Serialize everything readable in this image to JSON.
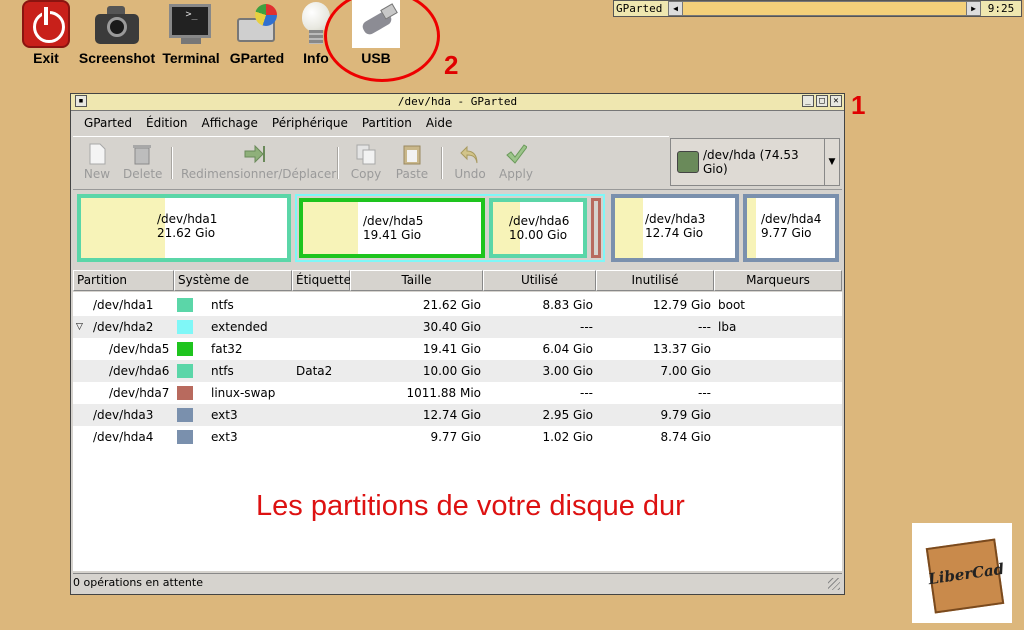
{
  "desktop": {
    "launchers": [
      {
        "label": "Exit",
        "icon": "power-icon"
      },
      {
        "label": "Screenshot",
        "icon": "camera-icon"
      },
      {
        "label": "Terminal",
        "icon": "terminal-icon"
      },
      {
        "label": "GParted",
        "icon": "gparted-icon"
      },
      {
        "label": "Info",
        "icon": "lightbulb-icon"
      },
      {
        "label": "USB",
        "icon": "usb-stick-icon"
      }
    ],
    "terminal_prompt": ">_",
    "annotation_1": "1",
    "annotation_2": "2",
    "caption": "Les partitions de votre disque dur",
    "logo_text": "LiberCad"
  },
  "taskbar": {
    "task_name": "GParted",
    "left_arrow": "◀",
    "right_arrow": "▶",
    "clock": "9:25"
  },
  "window": {
    "title": "/dev/hda - GParted",
    "menu": [
      "GParted",
      "Édition",
      "Affichage",
      "Périphérique",
      "Partition",
      "Aide"
    ],
    "toolbar": {
      "new": "New",
      "delete": "Delete",
      "resize": "Redimensionner/Déplacer",
      "copy": "Copy",
      "paste": "Paste",
      "undo": "Undo",
      "apply": "Apply"
    },
    "device_selector": "/dev/hda  (74.53 Gio)",
    "disk_map": [
      {
        "name": "/dev/hda1",
        "size": "21.62 Gio",
        "used_fraction": 0.41,
        "color": "#5bd6a8"
      },
      {
        "name": "/dev/hda5",
        "size": "19.41 Gio",
        "used_fraction": 0.31,
        "color": "#1ec41e"
      },
      {
        "name": "/dev/hda6",
        "size": "10.00 Gio",
        "used_fraction": 0.3,
        "color": "#5bd6a8"
      },
      {
        "name": "/dev/hda3",
        "size": "12.74 Gio",
        "used_fraction": 0.23,
        "color": "#7a90ad"
      },
      {
        "name": "/dev/hda4",
        "size": "9.77 Gio",
        "used_fraction": 0.1,
        "color": "#7a90ad"
      }
    ],
    "columns": [
      "Partition",
      "Système de fichiers",
      "Étiquette",
      "Taille",
      "Utilisé",
      "Inutilisé",
      "Marqueurs"
    ],
    "rows": [
      {
        "partition": "/dev/hda1",
        "fs": "ntfs",
        "label": "",
        "size": "21.62 Gio",
        "used": "8.83 Gio",
        "unused": "12.79 Gio",
        "flags": "boot",
        "color": "#5bd6a8"
      },
      {
        "partition": "/dev/hda2",
        "fs": "extended",
        "label": "",
        "size": "30.40 Gio",
        "used": "---",
        "unused": "---",
        "flags": "lba",
        "color": "#7ff7f7"
      },
      {
        "partition": "/dev/hda5",
        "fs": "fat32",
        "label": "",
        "size": "19.41 Gio",
        "used": "6.04 Gio",
        "unused": "13.37 Gio",
        "flags": "",
        "color": "#1ec41e"
      },
      {
        "partition": "/dev/hda6",
        "fs": "ntfs",
        "label": "Data2",
        "size": "10.00 Gio",
        "used": "3.00 Gio",
        "unused": "7.00 Gio",
        "flags": "",
        "color": "#5bd6a8"
      },
      {
        "partition": "/dev/hda7",
        "fs": "linux-swap",
        "label": "",
        "size": "1011.88 Mio",
        "used": "---",
        "unused": "---",
        "flags": "",
        "color": "#b86a5e"
      },
      {
        "partition": "/dev/hda3",
        "fs": "ext3",
        "label": "",
        "size": "12.74 Gio",
        "used": "2.95 Gio",
        "unused": "9.79 Gio",
        "flags": "",
        "color": "#7a90ad"
      },
      {
        "partition": "/dev/hda4",
        "fs": "ext3",
        "label": "",
        "size": "9.77 Gio",
        "used": "1.02 Gio",
        "unused": "8.74 Gio",
        "flags": "",
        "color": "#7a90ad"
      }
    ],
    "status": "0 opérations en attente"
  }
}
